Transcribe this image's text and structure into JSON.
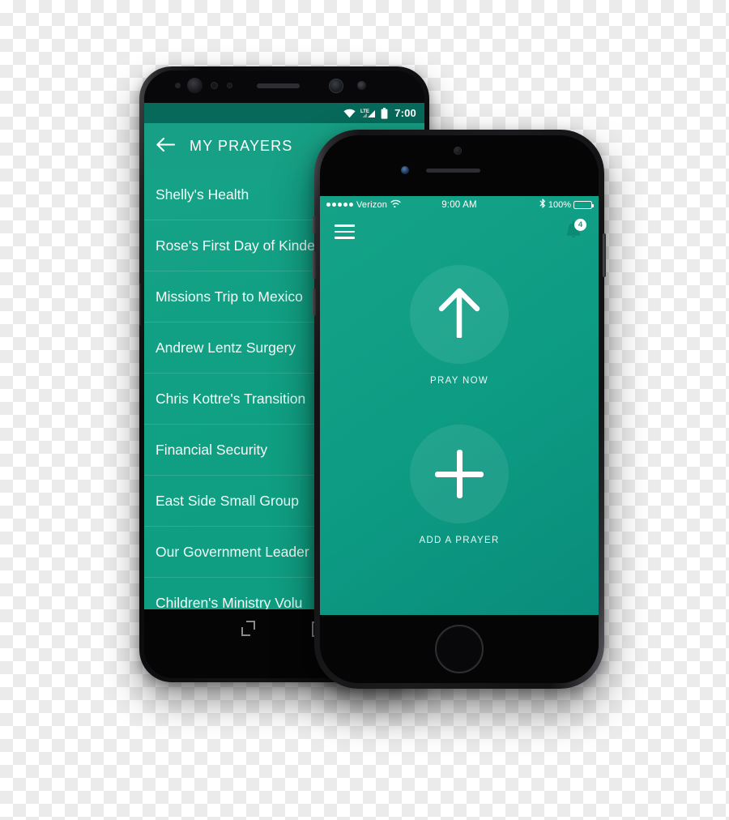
{
  "scene": {
    "title": "Prayer app shown on Android phone and iPhone mockups",
    "accent_color": "#0f9c82",
    "status_bar_color": "#07695a",
    "appbar_color": "#17a085"
  },
  "android": {
    "status_bar": {
      "wifi_icon": "wifi-icon",
      "network_label": "LTE",
      "signal_icon": "signal-icon",
      "battery_icon": "battery-icon",
      "time": "7:00"
    },
    "appbar": {
      "back_icon": "back-arrow-icon",
      "title": "MY PRAYERS"
    },
    "prayers": [
      "Shelly's Health",
      "Rose's First Day of Kinde",
      "Missions Trip to Mexico",
      "Andrew Lentz Surgery",
      "Chris Kottre's Transition",
      "Financial Security",
      "East Side Small Group",
      "Our Government Leader",
      "Children's Ministry Volu"
    ],
    "navbar": {
      "recents_icon": "recents-icon",
      "home_icon": "home-square-icon"
    }
  },
  "iphone": {
    "status_bar": {
      "signal_icon": "signal-dots-icon",
      "carrier": "Verizon",
      "wifi_icon": "wifi-icon",
      "time": "9:00 AM",
      "bluetooth_icon": "bluetooth-icon",
      "battery_percent": "100%",
      "battery_icon": "battery-icon"
    },
    "navrow": {
      "menu_icon": "hamburger-menu-icon",
      "bell_icon": "notification-bell-icon",
      "badge_count": "4"
    },
    "actions": [
      {
        "icon": "arrow-up-icon",
        "label": "PRAY NOW"
      },
      {
        "icon": "plus-icon",
        "label": "ADD A PRAYER"
      }
    ]
  }
}
